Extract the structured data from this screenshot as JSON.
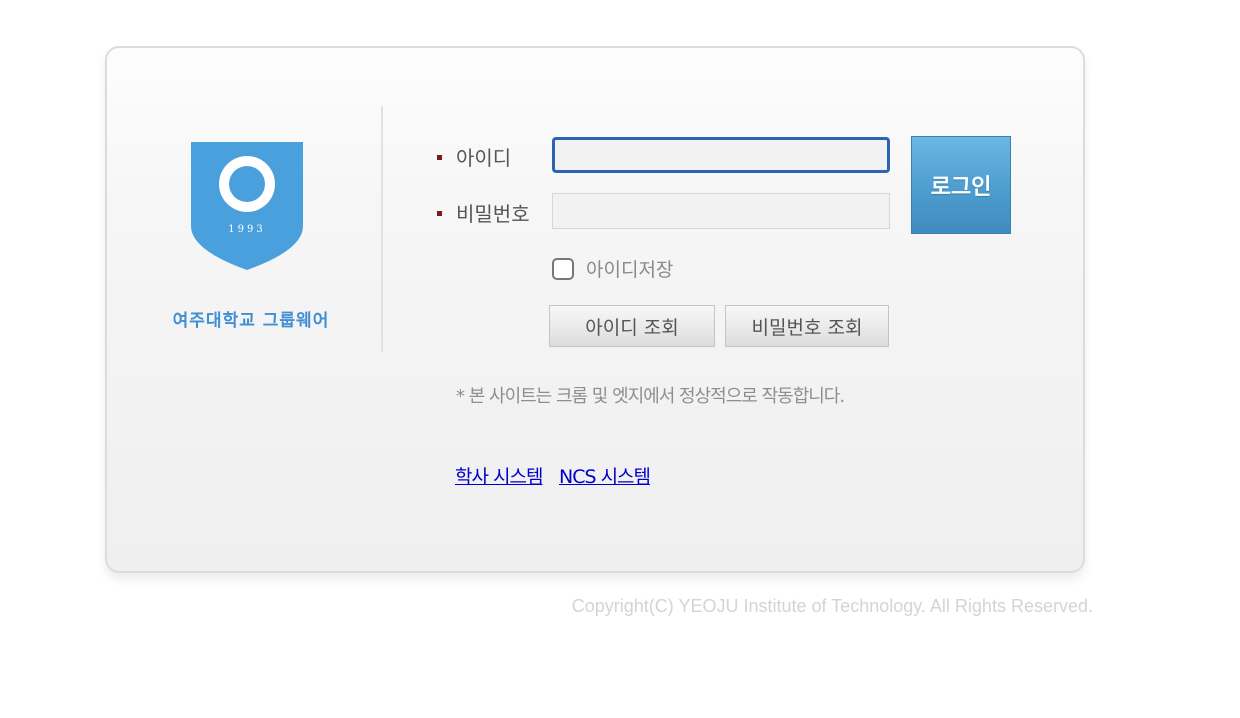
{
  "brand": {
    "name": "여주대학교 그룹웨어",
    "emblem_year": "1993",
    "emblem_color": "#4aa0dd"
  },
  "login": {
    "id_label": "아이디",
    "password_label": "비밀번호",
    "id_value": "",
    "password_value": "",
    "login_button": "로그인",
    "remember_label": "아이디저장",
    "remember_checked": false,
    "find_id_button": "아이디 조회",
    "find_password_button": "비밀번호 조회"
  },
  "notice": "* 본 사이트는 크롬 및 엣지에서 정상적으로 작동합니다.",
  "links": {
    "academic": "학사 시스템",
    "ncs": "NCS 시스템"
  },
  "footer": {
    "copyright": "Copyright(C) YEOJU Institute of Technology. All Rights Reserved."
  },
  "colors": {
    "accent": "#2d63b3",
    "login_button": "#4f9fd1",
    "link": "#0000cc"
  }
}
